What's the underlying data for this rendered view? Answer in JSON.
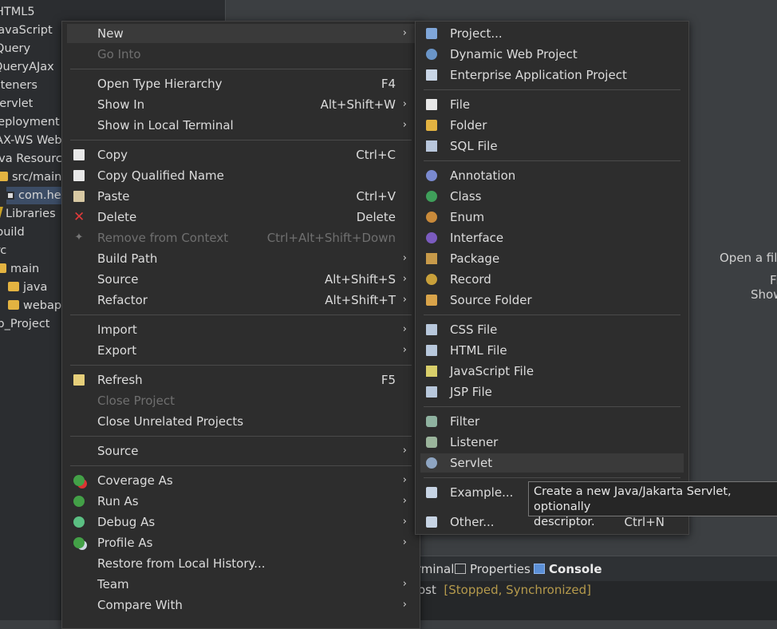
{
  "explorer": {
    "rows": [
      "HTML5",
      "JavaScript",
      "jQuery",
      "jQueryAJax",
      "Listeners",
      "Servlet",
      "Deployment",
      "JAX-WS Web",
      "Java Resources",
      "src/main/j",
      "com.he",
      "Libraries",
      "build",
      "src",
      "main",
      "java",
      "webapp",
      "Web_Project"
    ]
  },
  "editor": {
    "hint1": "Open a file",
    "hint2": "Fi",
    "hint3": "Show"
  },
  "bottom": {
    "tab_terminal": "Terminal",
    "tab_properties": "Properties",
    "tab_console": "Console",
    "status_prefix": "ost",
    "status": "[Stopped, Synchronized]"
  },
  "menu": {
    "new": "New",
    "go_into": "Go Into",
    "open_type_hierarchy": "Open Type Hierarchy",
    "open_type_hierarchy_sc": "F4",
    "show_in": "Show In",
    "show_in_sc": "Alt+Shift+W",
    "show_in_local_terminal": "Show in Local Terminal",
    "copy": "Copy",
    "copy_sc": "Ctrl+C",
    "copy_qualified_name": "Copy Qualified Name",
    "paste": "Paste",
    "paste_sc": "Ctrl+V",
    "delete": "Delete",
    "delete_sc": "Delete",
    "remove_from_context": "Remove from Context",
    "remove_from_context_sc": "Ctrl+Alt+Shift+Down",
    "build_path": "Build Path",
    "source": "Source",
    "source_sc": "Alt+Shift+S",
    "refactor": "Refactor",
    "refactor_sc": "Alt+Shift+T",
    "import": "Import",
    "export": "Export",
    "refresh": "Refresh",
    "refresh_sc": "F5",
    "close_project": "Close Project",
    "close_unrelated_projects": "Close Unrelated Projects",
    "source2": "Source",
    "coverage_as": "Coverage As",
    "run_as": "Run As",
    "debug_as": "Debug As",
    "profile_as": "Profile As",
    "restore_from_local_history": "Restore from Local History...",
    "team": "Team",
    "compare_with": "Compare With",
    "arrow": "›"
  },
  "submenu": {
    "project": "Project...",
    "dynamic_web_project": "Dynamic Web Project",
    "enterprise_application_project": "Enterprise Application Project",
    "file": "File",
    "folder": "Folder",
    "sql_file": "SQL File",
    "annotation": "Annotation",
    "class": "Class",
    "enum": "Enum",
    "interface": "Interface",
    "package": "Package",
    "record": "Record",
    "source_folder": "Source Folder",
    "css_file": "CSS File",
    "html_file": "HTML File",
    "javascript_file": "JavaScript File",
    "jsp_file": "JSP File",
    "filter": "Filter",
    "listener": "Listener",
    "servlet": "Servlet",
    "example": "Example...",
    "other": "Other...",
    "other_sc": "Ctrl+N"
  },
  "tooltip": {
    "line1": "Create a new Java/Jakarta Servlet, optionally",
    "line2": "descriptor."
  }
}
